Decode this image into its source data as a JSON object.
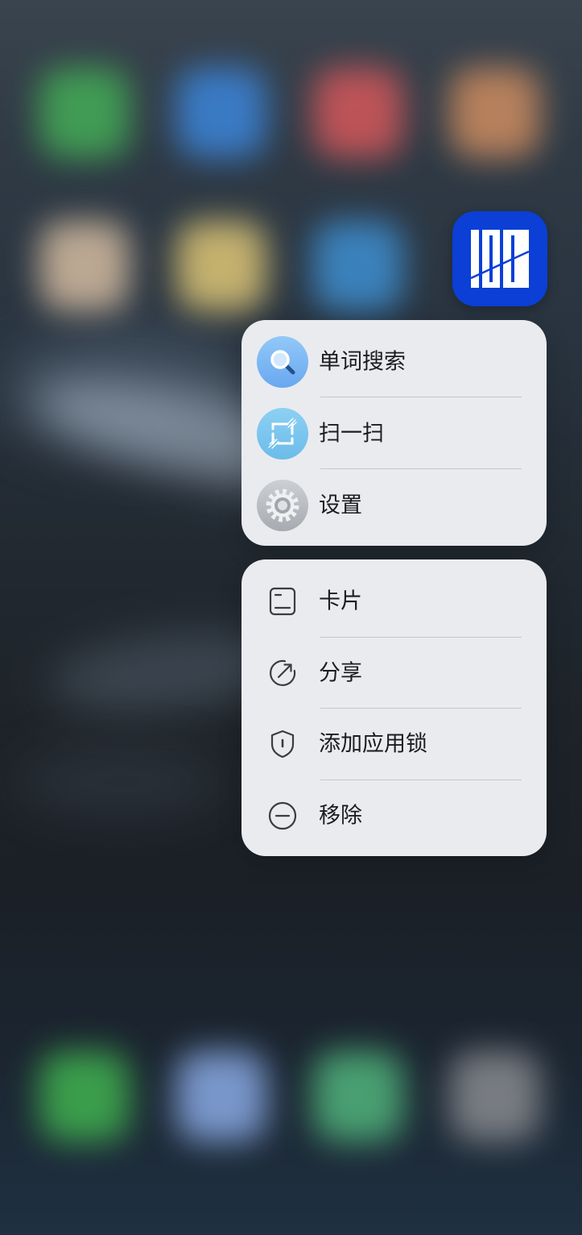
{
  "app_icon": {
    "icon": "hundred-logo-icon",
    "background_color": "#0b3fd6"
  },
  "quick_actions": [
    {
      "label": "单词搜索",
      "icon": "magnifier-icon"
    },
    {
      "label": "扫一扫",
      "icon": "scan-icon"
    },
    {
      "label": "设置",
      "icon": "gear-icon"
    }
  ],
  "system_actions": [
    {
      "label": "卡片",
      "icon": "card-icon"
    },
    {
      "label": "分享",
      "icon": "share-icon"
    },
    {
      "label": "添加应用锁",
      "icon": "shield-lock-icon"
    },
    {
      "label": "移除",
      "icon": "minus-circle-icon"
    }
  ],
  "theme": {
    "menu_bg": "#eaebef",
    "label_color": "#1c1c1e",
    "divider": "#c6c7cb",
    "app_icon_bg": "#0b3fd6",
    "outline_icon": "#3c3c40"
  }
}
